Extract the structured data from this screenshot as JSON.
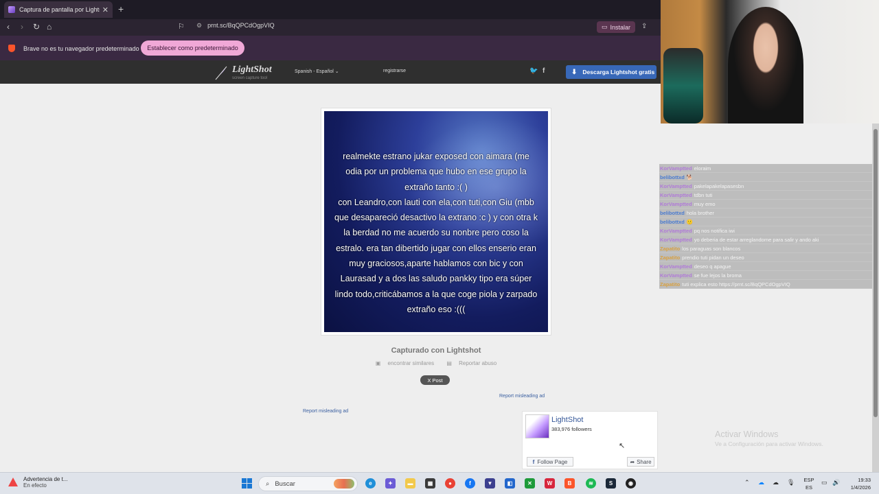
{
  "browser": {
    "tab_title": "Captura de pantalla por Lightsh",
    "new_tab": "+",
    "url": "prnt.sc/BqQPCdOgpVIQ",
    "install_label": "Instalar",
    "infobar_message": "Brave no es tu navegador predeterminado",
    "set_default_label": "Establecer como predeterminado"
  },
  "lightshot": {
    "logo_name": "LightShot",
    "logo_tag": "screen capture tool",
    "language": "Spanish - Español ⌄",
    "register": "registrarse",
    "download_label": "Descarga Lightshot gratis",
    "captured_with": "Capturado con Lightshot",
    "find_similar": "encontrar similares",
    "report_abuse": "Reportar abuso",
    "post_label": "X Post",
    "report_ad_1": "Report misleading ad",
    "report_ad_2": "Report misleading ad"
  },
  "screenshot_text": [
    "realmekte estrano jukar exposed con aimara (me",
    "odia por un problema que hubo en ese grupo la",
    "extraño tanto :( )",
    "con Leandro,con lauti con ela,con tuti,con Giu (mbb",
    "que desapareció desactivo la extrano :c ) y con otra k",
    "la berdad no me acuerdo su nonbre pero coso la",
    "estralo. era tan dibertido jugar con ellos enserio eran",
    "muy graciosos,aparte hablamos con bic y con",
    "Laurasad y a dos las saludo pankky tipo era súper",
    "lindo todo,criticábamos a la que coge piola y zarpado",
    "extraño eso  :((("
  ],
  "facebook": {
    "page_name": "LightShot",
    "followers": "383,976 followers",
    "follow_label": "Follow Page",
    "share_label": "Share"
  },
  "chat": [
    {
      "user": "KorVamptted",
      "text": "eloraim",
      "color": "#b07ad8"
    },
    {
      "user": "belibottxd",
      "text": "🐕",
      "color": "#4a7bd0"
    },
    {
      "user": "KorVamptted",
      "text": "pakelapakelapasesbn",
      "color": "#b07ad8"
    },
    {
      "user": "KorVamptted",
      "text": "tdbn tuti",
      "color": "#b07ad8"
    },
    {
      "user": "KorVamptted",
      "text": "muy emo",
      "color": "#b07ad8"
    },
    {
      "user": "belibottxd",
      "text": "hola brother",
      "color": "#4a7bd0"
    },
    {
      "user": "belibottxd",
      "text": "🙂",
      "color": "#4a7bd0"
    },
    {
      "user": "KorVamptted",
      "text": "pq nos notifica iwi",
      "color": "#b07ad8"
    },
    {
      "user": "KorVamptted",
      "text": "yo deberia de estar arreglandome para salir y ando aki",
      "color": "#b07ad8"
    },
    {
      "user": "Zapatito",
      "text": "los paraguas son blancos",
      "color": "#d8a040"
    },
    {
      "user": "Zapatito",
      "text": "prendio tuti pidan un deseo",
      "color": "#d8a040"
    },
    {
      "user": "KorVamptted",
      "text": "deseo q apague",
      "color": "#b07ad8"
    },
    {
      "user": "KorVamptted",
      "text": "se fue lejos la broma",
      "color": "#b07ad8"
    },
    {
      "user": "Zapatito",
      "text": "tuti explica esto https://prnt.sc/BqQPCdOgpVIQ",
      "color": "#d8a040"
    }
  ],
  "windows": {
    "activate_title": "Activar Windows",
    "activate_sub": "Ve a Configuración para activar Windows.",
    "weather_title": "Advertencia de t...",
    "weather_sub": "En efecto",
    "search_label": "Buscar",
    "lang_1": "ESP",
    "lang_2": "ES",
    "time": "19:33",
    "date": "1/4/2026"
  }
}
